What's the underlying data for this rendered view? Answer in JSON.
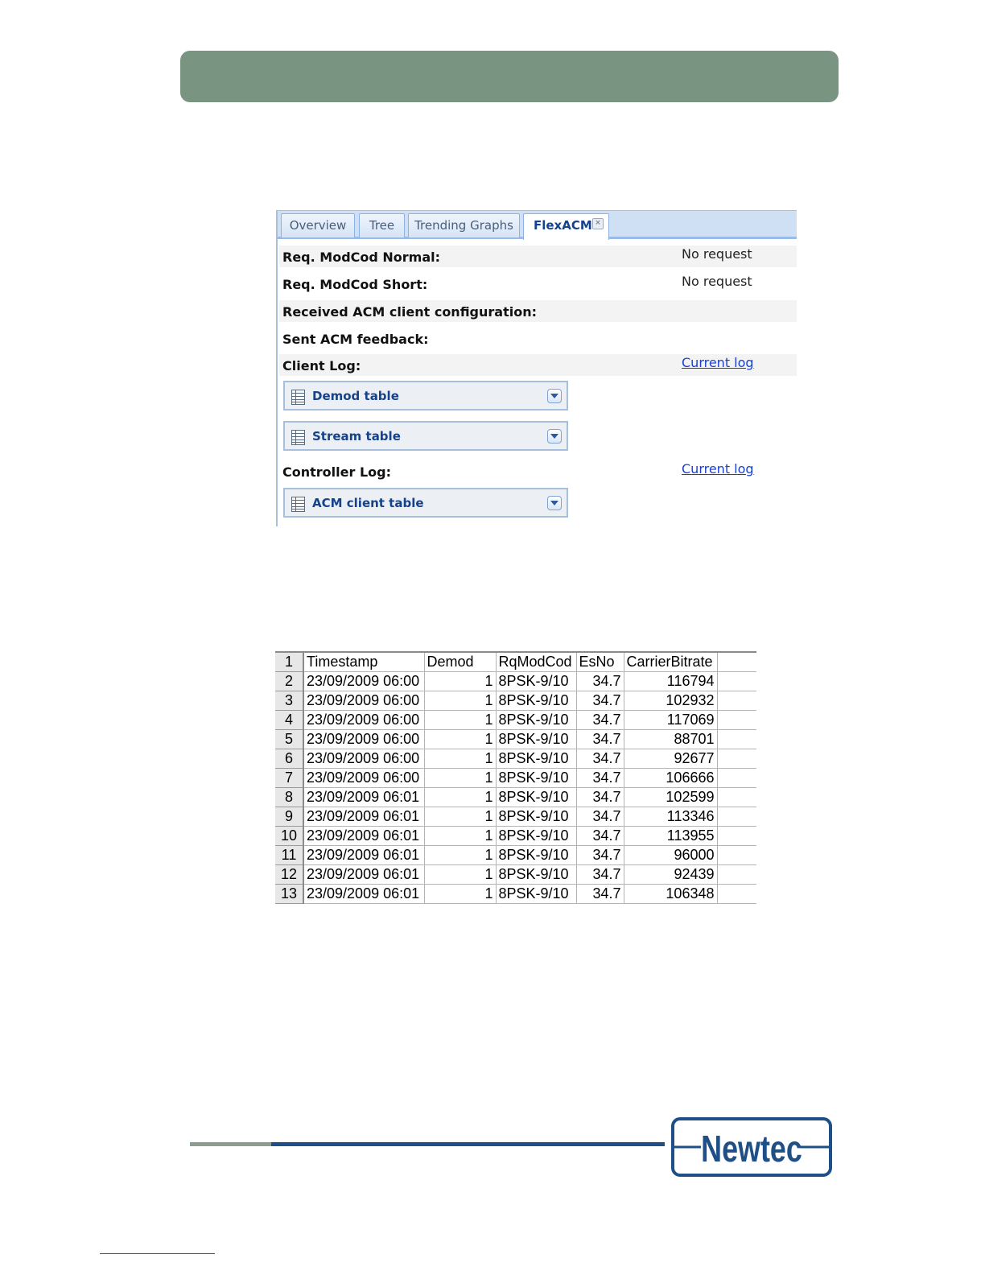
{
  "tabs": [
    {
      "label": "Overview",
      "active": false
    },
    {
      "label": "Tree",
      "active": false
    },
    {
      "label": "Trending Graphs",
      "active": false
    },
    {
      "label": "FlexACM",
      "active": true
    }
  ],
  "flexacm": {
    "req_modcod_normal": {
      "label": "Req. ModCod Normal:",
      "value": "No request"
    },
    "req_modcod_short": {
      "label": "Req. ModCod Short:",
      "value": "No request"
    },
    "received_config": {
      "label": "Received ACM client configuration:"
    },
    "sent_feedback": {
      "label": "Sent ACM feedback:"
    },
    "client_log": {
      "label": "Client Log:",
      "link": "Current log"
    },
    "demod_table": "Demod table",
    "stream_table": "Stream table",
    "controller_log": {
      "label": "Controller Log:",
      "link": "Current log"
    },
    "acm_client_table": "ACM client table"
  },
  "sheet": {
    "headers": [
      "Timestamp",
      "Demod",
      "RqModCod",
      "EsNo",
      "CarrierBitrate"
    ],
    "rows": [
      [
        "23/09/2009 06:00",
        "1",
        "8PSK-9/10",
        "34.7",
        "116794"
      ],
      [
        "23/09/2009 06:00",
        "1",
        "8PSK-9/10",
        "34.7",
        "102932"
      ],
      [
        "23/09/2009 06:00",
        "1",
        "8PSK-9/10",
        "34.7",
        "117069"
      ],
      [
        "23/09/2009 06:00",
        "1",
        "8PSK-9/10",
        "34.7",
        "88701"
      ],
      [
        "23/09/2009 06:00",
        "1",
        "8PSK-9/10",
        "34.7",
        "92677"
      ],
      [
        "23/09/2009 06:00",
        "1",
        "8PSK-9/10",
        "34.7",
        "106666"
      ],
      [
        "23/09/2009 06:01",
        "1",
        "8PSK-9/10",
        "34.7",
        "102599"
      ],
      [
        "23/09/2009 06:01",
        "1",
        "8PSK-9/10",
        "34.7",
        "113346"
      ],
      [
        "23/09/2009 06:01",
        "1",
        "8PSK-9/10",
        "34.7",
        "113955"
      ],
      [
        "23/09/2009 06:01",
        "1",
        "8PSK-9/10",
        "34.7",
        "96000"
      ],
      [
        "23/09/2009 06:01",
        "1",
        "8PSK-9/10",
        "34.7",
        "92439"
      ],
      [
        "23/09/2009 06:01",
        "1",
        "8PSK-9/10",
        "34.7",
        "106348"
      ]
    ]
  },
  "logo": {
    "text": "Newtec"
  },
  "colors": {
    "header_bar": "#7a9482",
    "brand_blue": "#1e4f86",
    "link": "#1a3fcf"
  }
}
